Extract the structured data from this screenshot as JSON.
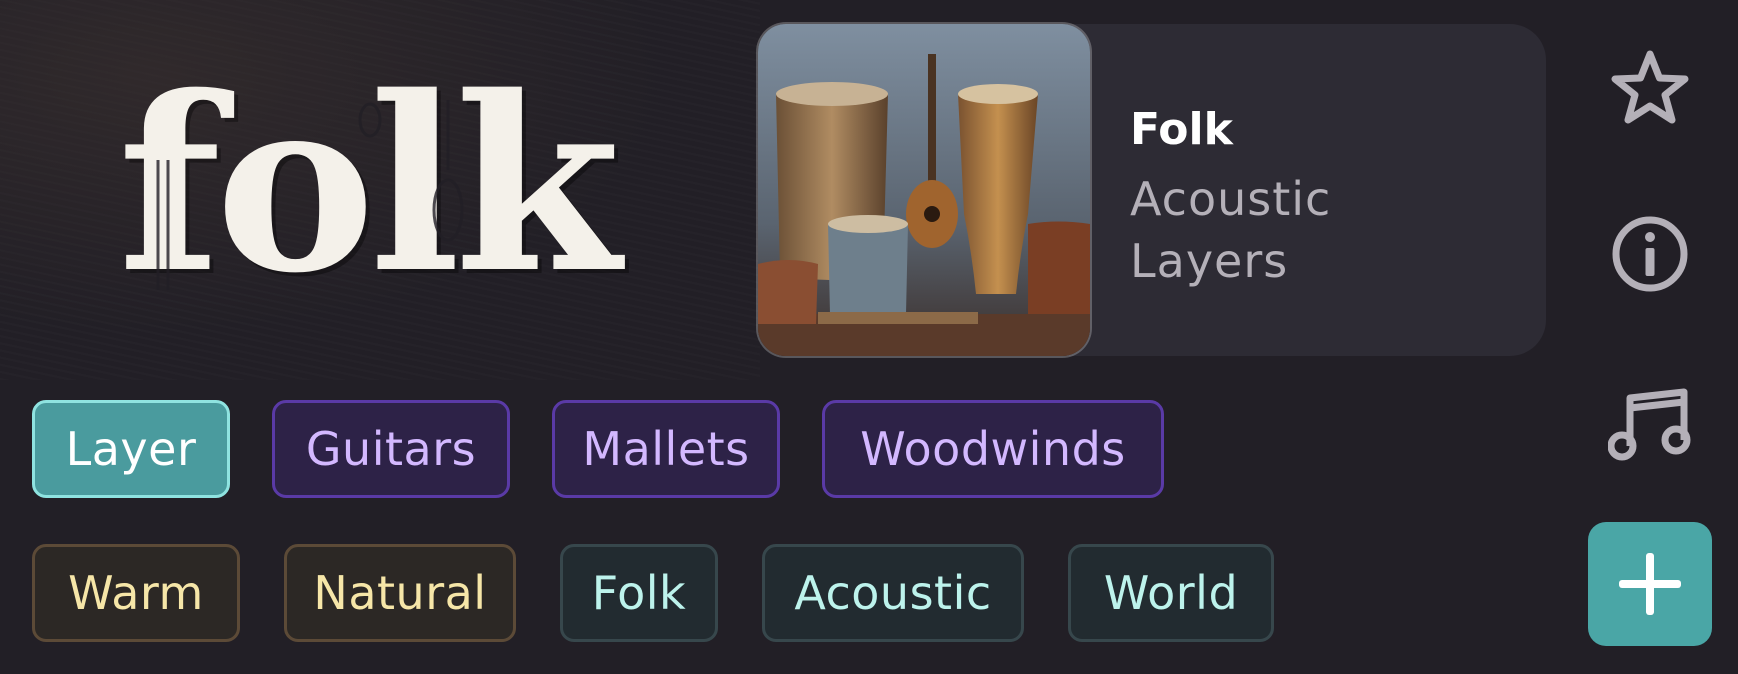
{
  "logo": {
    "text": "folk"
  },
  "preset": {
    "title": "Folk",
    "subtitle_line1": "Acoustic",
    "subtitle_line2": "Layers",
    "cover_image": "folk-instruments-photo"
  },
  "side_actions": {
    "favorite_icon": "star-icon",
    "info_icon": "info-icon",
    "music_icon": "music-note-icon",
    "add_icon": "plus-icon"
  },
  "tags_row1": [
    {
      "label": "Layer",
      "style": "teal"
    },
    {
      "label": "Guitars",
      "style": "purple"
    },
    {
      "label": "Mallets",
      "style": "purple"
    },
    {
      "label": "Woodwinds",
      "style": "purple"
    }
  ],
  "tags_row2": [
    {
      "label": "Warm",
      "style": "warm"
    },
    {
      "label": "Natural",
      "style": "warm"
    },
    {
      "label": "Folk",
      "style": "cyan"
    },
    {
      "label": "Acoustic",
      "style": "cyan"
    },
    {
      "label": "World",
      "style": "cyan"
    }
  ],
  "colors": {
    "background": "#221f26",
    "card": "#2d2b34",
    "accent_teal": "#4aa6a6",
    "tag_purple_text": "#d3b8ff",
    "tag_warm_text": "#f6e6a8",
    "tag_cyan_text": "#bdf3ec"
  }
}
